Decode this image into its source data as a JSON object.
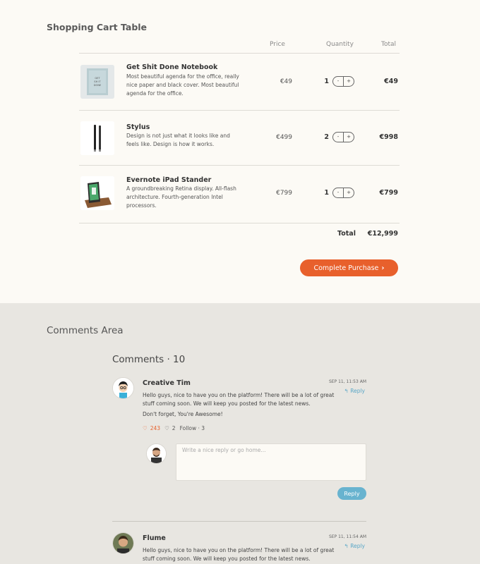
{
  "cart": {
    "title": "Shopping Cart Table",
    "headers": {
      "price": "Price",
      "quantity": "Quantity",
      "total": "Total"
    },
    "items": [
      {
        "name": "Get Shit Done Notebook",
        "description": "Most beautiful agenda for the office, really nice paper and black cover. Most beautiful agenda for the office.",
        "thumb_text": "GET SH IT DONE",
        "price": "€49",
        "quantity": "1",
        "total": "€49"
      },
      {
        "name": "Stylus",
        "description": "Design is not just what it looks like and feels like. Design is how it works.",
        "price": "€499",
        "quantity": "2",
        "total": "€998"
      },
      {
        "name": "Evernote iPad Stander",
        "description": "A groundbreaking Retina display. All-flash architecture. Fourth-generation Intel processors.",
        "price": "€799",
        "quantity": "1",
        "total": "€799"
      }
    ],
    "stepper": {
      "minus": "-",
      "plus": "+"
    },
    "summary": {
      "label": "Total",
      "value": "€12,999"
    },
    "purchase_button": "Complete Purchase",
    "purchase_icon": "›"
  },
  "comments": {
    "section_title": "Comments Area",
    "header": "Comments · 10",
    "items": [
      {
        "author": "Creative Tim",
        "date": "SEP 11, 11:53 AM",
        "reply_label": "Reply",
        "text1": "Hello guys, nice to have you on the platform! There will be a lot of great stuff coming soon. We will keep you posted for the latest news.",
        "text2": "Don't forget, You're Awesome!",
        "likes": "243",
        "loves": "2",
        "follow": "Follow · 3"
      },
      {
        "author": "Flume",
        "date": "SEP 11, 11:54 AM",
        "reply_label": "Reply",
        "text1": "Hello guys, nice to have you on the platform! There will be a lot of great stuff coming soon. We will keep you posted for the latest news."
      }
    ],
    "reply_form": {
      "placeholder": "Write a nice reply or go home...",
      "button": "Reply"
    }
  },
  "colors": {
    "accent_orange": "#e8602c",
    "accent_blue": "#68b3cf",
    "cart_bg": "#fcfaf5",
    "comments_bg": "#e8e6e1"
  },
  "icons": [
    "heart-icon",
    "heart-outline-icon",
    "reply-arrow-icon",
    "chevron-right-icon"
  ]
}
